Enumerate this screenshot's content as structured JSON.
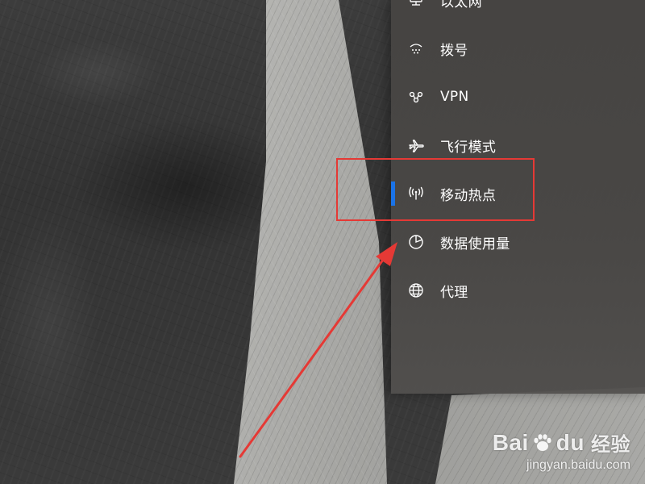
{
  "nav": {
    "items": [
      {
        "label": "以太网",
        "icon": "ethernet-icon",
        "active": false
      },
      {
        "label": "拨号",
        "icon": "dialup-icon",
        "active": false
      },
      {
        "label": "VPN",
        "icon": "vpn-icon",
        "active": false
      },
      {
        "label": "飞行模式",
        "icon": "airplane-icon",
        "active": false
      },
      {
        "label": "移动热点",
        "icon": "hotspot-icon",
        "active": true
      },
      {
        "label": "数据使用量",
        "icon": "data-usage-icon",
        "active": false
      },
      {
        "label": "代理",
        "icon": "globe-icon",
        "active": false
      }
    ]
  },
  "colors": {
    "accent": "#1a73e8",
    "annotation": "#e53935",
    "panel_bg": "#474543"
  },
  "watermark": {
    "brand_left": "Bai",
    "brand_right": "du",
    "brand_cn": "经验",
    "url": "jingyan.baidu.com"
  }
}
